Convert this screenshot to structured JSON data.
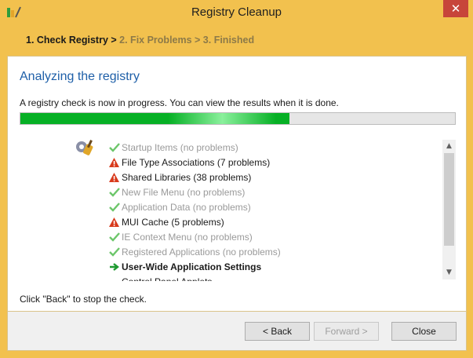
{
  "window": {
    "title": "Registry Cleanup",
    "close_glyph": "✕"
  },
  "breadcrumb": {
    "step1": "1. Check Registry >",
    "rest": " 2. Fix Problems > 3. Finished"
  },
  "main": {
    "heading": "Analyzing the registry",
    "info": "A registry check is now in progress. You can view the results when it is done.",
    "progress_fraction": 0.62,
    "items": [
      {
        "label": "Startup Items (no problems)",
        "status": "ok"
      },
      {
        "label": "File Type Associations (7 problems)",
        "status": "warn"
      },
      {
        "label": "Shared Libraries (38 problems)",
        "status": "warn"
      },
      {
        "label": "New File Menu (no problems)",
        "status": "ok"
      },
      {
        "label": "Application Data (no problems)",
        "status": "ok"
      },
      {
        "label": "MUI Cache (5 problems)",
        "status": "warn"
      },
      {
        "label": "IE Context Menu (no problems)",
        "status": "ok"
      },
      {
        "label": "Registered Applications (no problems)",
        "status": "ok"
      },
      {
        "label": "User-Wide Application Settings",
        "status": "current"
      },
      {
        "label": "Control Panel Applets",
        "status": "pending"
      }
    ],
    "hint": "Click \"Back\" to stop the check."
  },
  "footer": {
    "back_label": "< Back",
    "forward_label": "Forward >",
    "close_label": "Close"
  },
  "colors": {
    "titlebar": "#f2c14e",
    "heading": "#1e5fa8",
    "progress": "#06b025",
    "ok_check": "#6cc66a",
    "warn": "#d83a1c",
    "arrow": "#1e9a30"
  },
  "icons": {
    "app": "registry-broom-icon",
    "scanner": "gear-broom-icon",
    "ok": "checkmark-icon",
    "warn": "warning-triangle-icon",
    "current": "right-arrow-icon"
  }
}
